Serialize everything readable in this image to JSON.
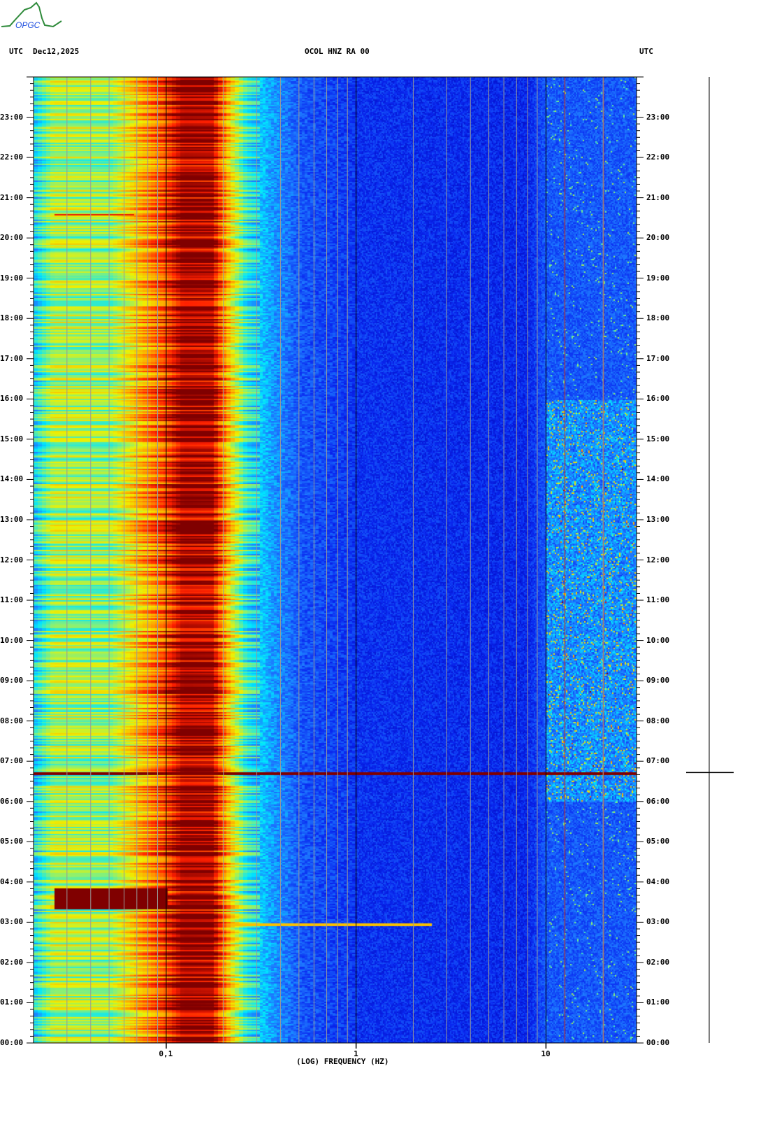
{
  "header": {
    "logo_text": "OPGC",
    "left_label": "UTC",
    "date": "Dec12,2025",
    "station": "OCOL HNZ RA 00",
    "right_label": "UTC"
  },
  "chart_data": {
    "type": "heatmap",
    "subtype": "spectrogram",
    "title": "OCOL HNZ RA 00",
    "xlabel": "(LOG) FREQUENCY (HZ)",
    "ylabel": "UTC",
    "xscale": "log",
    "xlim_hz": [
      0.02,
      30
    ],
    "ylim_hours": [
      0,
      24
    ],
    "x_ticks": [
      {
        "value": 0.1,
        "label": "0,1"
      },
      {
        "value": 1,
        "label": "1"
      },
      {
        "value": 10,
        "label": "10"
      }
    ],
    "y_ticks": [
      "00:00",
      "01:00",
      "02:00",
      "03:00",
      "04:00",
      "05:00",
      "06:00",
      "07:00",
      "08:00",
      "09:00",
      "10:00",
      "11:00",
      "12:00",
      "13:00",
      "14:00",
      "15:00",
      "16:00",
      "17:00",
      "18:00",
      "19:00",
      "20:00",
      "21:00",
      "22:00",
      "23:00"
    ],
    "colormap": [
      "#0000b0",
      "#0a28f0",
      "#1e78ff",
      "#00e8ff",
      "#80f080",
      "#f0f000",
      "#ffa000",
      "#ff2000",
      "#800000"
    ],
    "band_levels": [
      {
        "f": 0.02,
        "level": 0.38
      },
      {
        "f": 0.025,
        "level": 0.55
      },
      {
        "f": 0.05,
        "level": 0.52
      },
      {
        "f": 0.07,
        "level": 0.7
      },
      {
        "f": 0.1,
        "level": 0.86
      },
      {
        "f": 0.12,
        "level": 0.98
      },
      {
        "f": 0.17,
        "level": 0.97
      },
      {
        "f": 0.19,
        "level": 0.82
      },
      {
        "f": 0.22,
        "level": 0.62
      },
      {
        "f": 0.26,
        "level": 0.42
      },
      {
        "f": 0.35,
        "level": 0.3
      },
      {
        "f": 0.5,
        "level": 0.2
      },
      {
        "f": 1,
        "level": 0.14
      },
      {
        "f": 8,
        "level": 0.12
      },
      {
        "f": 10,
        "level": 0.2
      },
      {
        "f": 30,
        "level": 0.2
      }
    ],
    "high_freq_activity": {
      "f_range": [
        10,
        30
      ],
      "hours": [
        6,
        16
      ],
      "boost": 0.15
    },
    "events": [
      {
        "hour": 6.72,
        "f_range": [
          0.02,
          30
        ],
        "level": 1.0,
        "duration_h": 0.06
      },
      {
        "hour": 3.6,
        "f_range": [
          0.025,
          0.1
        ],
        "level": 1.0,
        "duration_h": 0.5
      },
      {
        "hour": 2.95,
        "f_range": [
          0.2,
          2.5
        ],
        "level": 0.7,
        "duration_h": 0.06
      },
      {
        "hour": 20.6,
        "f_range": [
          0.025,
          0.065
        ],
        "level": 0.9,
        "duration_h": 0.05
      }
    ],
    "persistent_lines_hz": [
      12.5,
      20
    ],
    "trace_event_hour": 6.72
  }
}
